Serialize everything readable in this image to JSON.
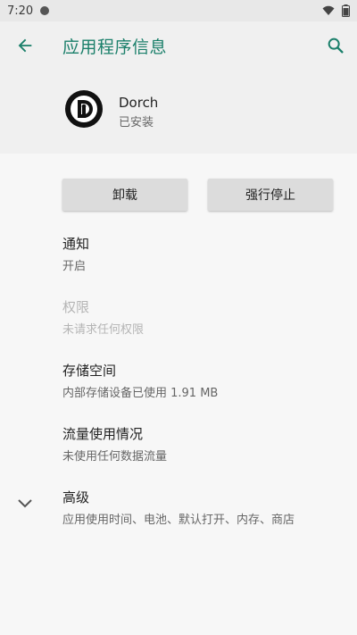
{
  "status_bar": {
    "time": "7:20"
  },
  "app_bar": {
    "title": "应用程序信息"
  },
  "app": {
    "name": "Dorch",
    "status": "已安装"
  },
  "buttons": {
    "uninstall": "卸载",
    "force_stop": "强行停止"
  },
  "settings": [
    {
      "title": "通知",
      "subtitle": "开启"
    },
    {
      "title": "权限",
      "subtitle": "未请求任何权限"
    },
    {
      "title": "存储空间",
      "subtitle": "内部存储设备已使用 1.91 MB"
    },
    {
      "title": "流量使用情况",
      "subtitle": "未使用任何数据流量"
    },
    {
      "title": "高级",
      "subtitle": "应用使用时间、电池、默认打开、内存、商店"
    }
  ],
  "colors": {
    "accent": "#1a7f6a",
    "header_bg": "#f0f0f0",
    "page_bg": "#f7f7f7",
    "button_bg": "#dcdcdc"
  },
  "icons": [
    "back-arrow-icon",
    "search-icon",
    "wifi-icon",
    "battery-icon",
    "chevron-down-icon",
    "app-logo-icon"
  ]
}
